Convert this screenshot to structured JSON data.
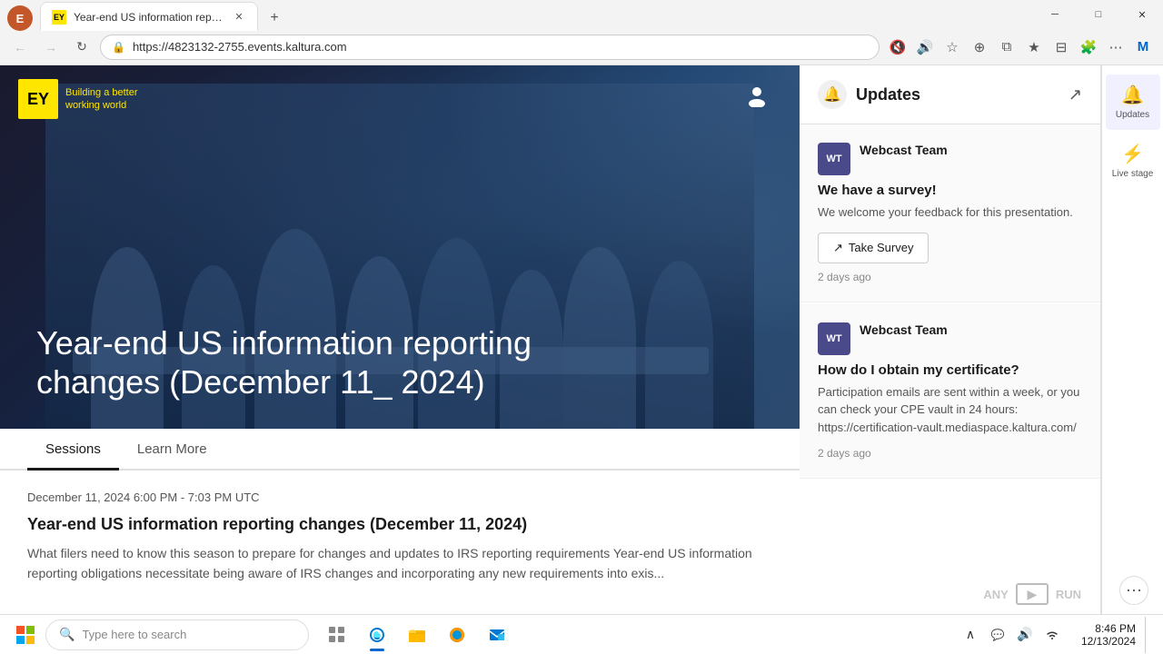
{
  "browser": {
    "tab_title": "Year-end US information reporti...",
    "url": "https://4823132-2755.events.kaltura.com",
    "favicon": "Y"
  },
  "toolbar": {
    "back": "←",
    "forward": "→",
    "refresh": "↻",
    "mute": "🔇",
    "read_aloud": "📢",
    "favorites": "☆",
    "browser_extras": "⊕",
    "split": "⧉",
    "favorites_bar": "★",
    "collections": "⊟",
    "extensions": "🧩",
    "settings": "⋯",
    "copilot": "M"
  },
  "page": {
    "logo_text": "EY",
    "logo_tagline": "Building a better\nworking world",
    "hero_title": "Year-end US information reporting\nchanges (December 11_ 2024)",
    "tabs": [
      {
        "label": "Sessions",
        "active": true
      },
      {
        "label": "Learn More",
        "active": false
      }
    ],
    "session_date": "December 11, 2024  6:00 PM - 7:03 PM UTC",
    "session_title": "Year-end US information reporting changes (December 11, 2024)",
    "session_description": "What filers need to know this season to prepare for changes and updates to IRS reporting requirements Year-end US information reporting obligations necessitate being aware of IRS changes and incorporating any new requirements into exis..."
  },
  "updates_panel": {
    "title": "Updates",
    "messages": [
      {
        "sender_initials": "WT",
        "sender_name": "Webcast Team",
        "subject": "We have a survey!",
        "body": "We welcome your feedback for this presentation.",
        "cta_label": "Take Survey",
        "time": "2 days ago"
      },
      {
        "sender_initials": "WT",
        "sender_name": "Webcast Team",
        "subject": "How do I obtain my certificate?",
        "body": "Participation emails are sent within a week, or you can check your CPE vault in 24 hours: https://certification-vault.mediaspace.kaltura.com/",
        "time": "2 days ago"
      }
    ]
  },
  "side_nav": [
    {
      "icon": "🔔",
      "label": "Updates",
      "active": true
    },
    {
      "icon": "⚡",
      "label": "Live stage",
      "active": false
    }
  ],
  "taskbar": {
    "search_placeholder": "Type here to search",
    "time": "8:46 PM",
    "date": "12/13/2024",
    "apps": [
      {
        "label": "Task View",
        "icon": "⊞"
      },
      {
        "label": "Edge",
        "icon": "e",
        "active": true
      },
      {
        "label": "File Explorer",
        "icon": "📁"
      },
      {
        "label": "Firefox",
        "icon": "🦊"
      },
      {
        "label": "Outlook",
        "icon": "O"
      }
    ],
    "tray_icons": [
      "🔺",
      "💬",
      "🔊",
      "📶"
    ]
  }
}
